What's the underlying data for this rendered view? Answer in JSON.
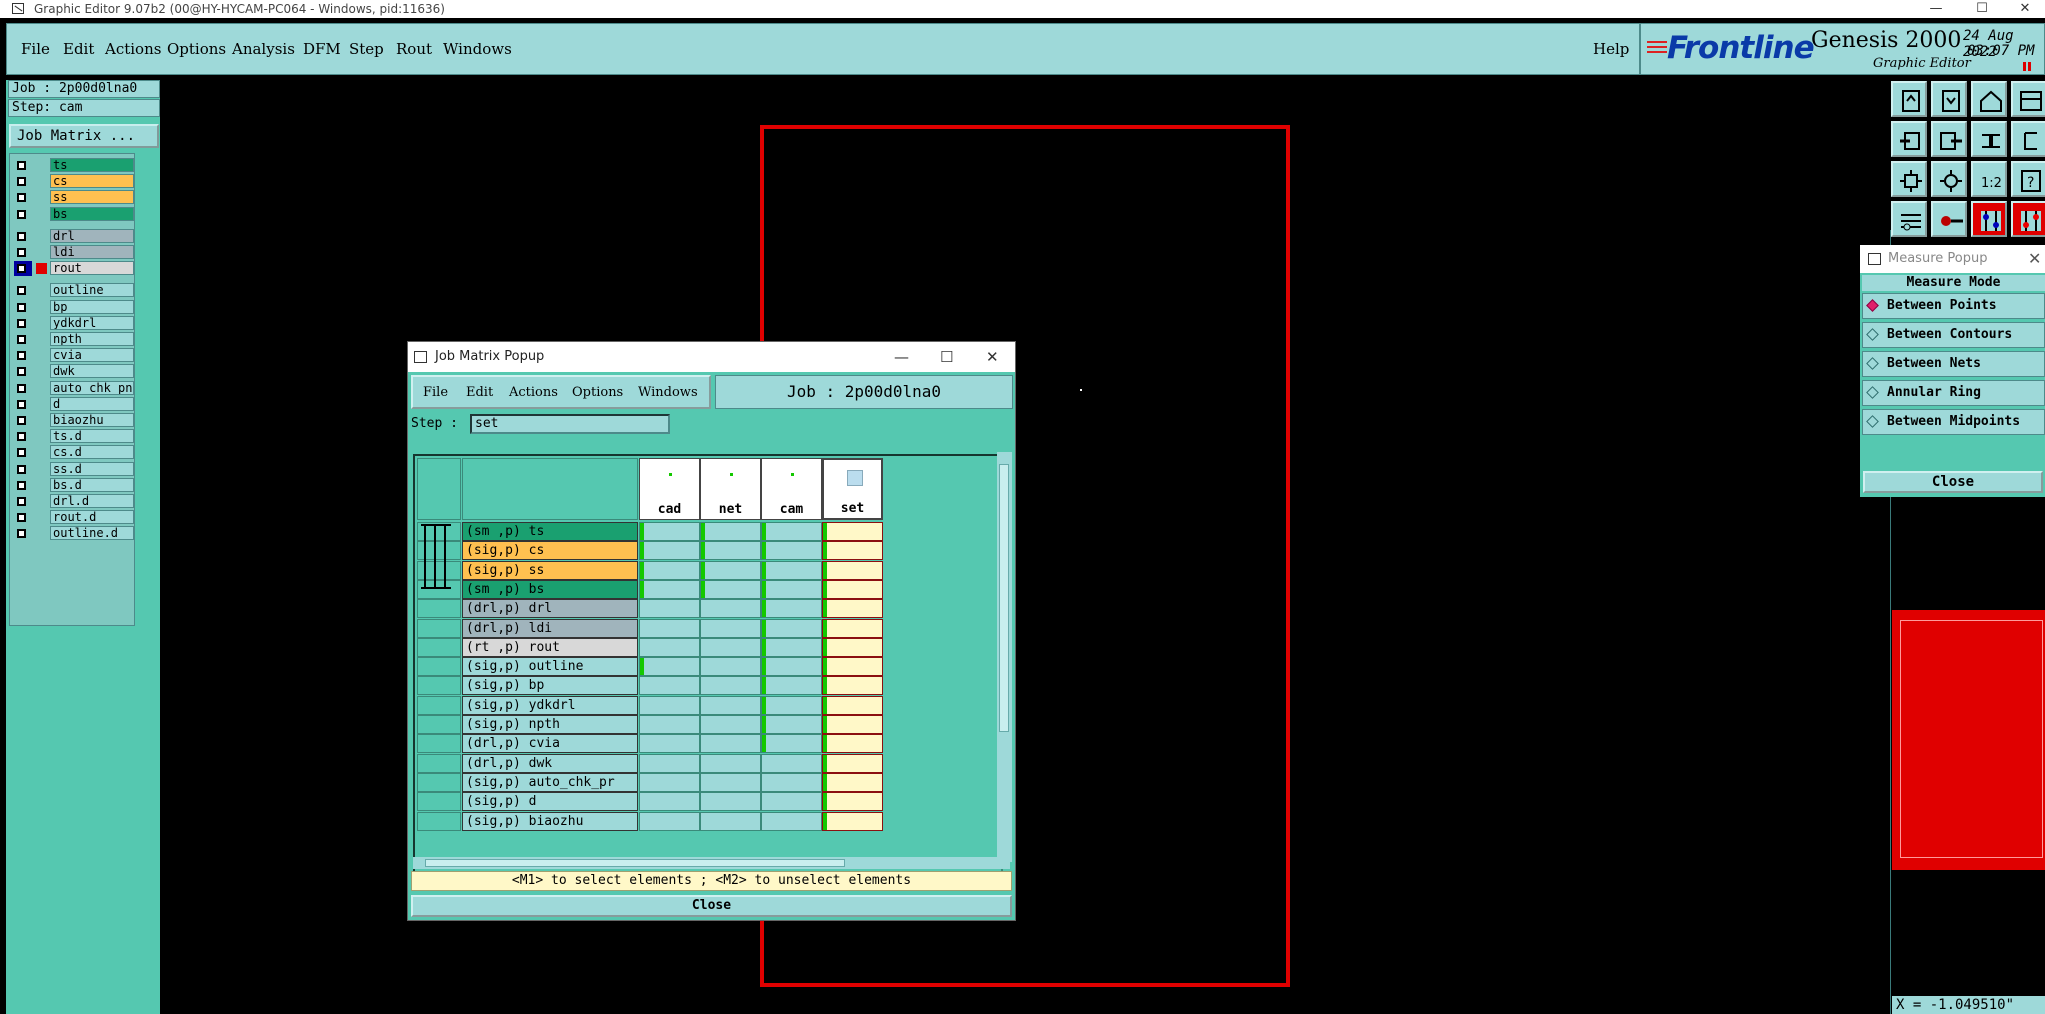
{
  "window": {
    "title": "Graphic Editor 9.07b2 (00@HY-HYCAM-PC064 - Windows, pid:11636)"
  },
  "menubar": {
    "items": [
      "File",
      "Edit",
      "Actions",
      "Options",
      "Analysis",
      "DFM",
      "Step",
      "Rout",
      "Windows"
    ],
    "help": "Help"
  },
  "brand": {
    "logo": "Frontline",
    "product": "Genesis 2000",
    "subtitle": "Graphic Editor",
    "date": "24 Aug 2022",
    "time": "03:07 PM"
  },
  "leftpanel": {
    "job": "Job : 2p00d0lna0",
    "step": "Step: cam",
    "job_matrix_button": "Job Matrix ...",
    "layers": [
      {
        "name": "ts",
        "color": "#1aa070"
      },
      {
        "name": "cs",
        "color": "#ffc050"
      },
      {
        "name": "ss",
        "color": "#ffc050"
      },
      {
        "name": "bs",
        "color": "#1aa070"
      },
      {
        "name": "drl",
        "color": "#a0b4bc"
      },
      {
        "name": "ldi",
        "color": "#a0b4bc"
      },
      {
        "name": "rout",
        "color": "#d8d8d8",
        "selected": true
      },
      {
        "name": "outline",
        "color": "#9ed9d9"
      },
      {
        "name": "bp",
        "color": "#9ed9d9"
      },
      {
        "name": "ydkdrl",
        "color": "#9ed9d9"
      },
      {
        "name": "npth",
        "color": "#9ed9d9"
      },
      {
        "name": "cvia",
        "color": "#9ed9d9"
      },
      {
        "name": "dwk",
        "color": "#9ed9d9"
      },
      {
        "name": "auto_chk_pn.",
        "color": "#9ed9d9"
      },
      {
        "name": "d",
        "color": "#9ed9d9"
      },
      {
        "name": "biaozhu",
        "color": "#9ed9d9"
      },
      {
        "name": "ts.d",
        "color": "#9ed9d9"
      },
      {
        "name": "cs.d",
        "color": "#9ed9d9"
      },
      {
        "name": "ss.d",
        "color": "#9ed9d9"
      },
      {
        "name": "bs.d",
        "color": "#9ed9d9"
      },
      {
        "name": "drl.d",
        "color": "#9ed9d9"
      },
      {
        "name": "rout.d",
        "color": "#9ed9d9"
      },
      {
        "name": "outline.d",
        "color": "#9ed9d9"
      }
    ]
  },
  "measure_popup": {
    "title": "Measure Popup",
    "header": "Measure Mode",
    "options": [
      {
        "label": "Between Points",
        "selected": true
      },
      {
        "label": "Between Contours",
        "selected": false
      },
      {
        "label": "Between Nets",
        "selected": false
      },
      {
        "label": "Annular Ring",
        "selected": false
      },
      {
        "label": "Between Midpoints",
        "selected": false
      }
    ],
    "close": "Close"
  },
  "job_matrix_popup": {
    "title": "Job Matrix Popup",
    "menu": [
      "File",
      "Edit",
      "Actions",
      "Options",
      "Windows"
    ],
    "job_label": "Job : 2p00d0lna0",
    "step_label": "Step :",
    "step_value": "set",
    "columns": [
      "cad",
      "net",
      "cam",
      "set"
    ],
    "rows": [
      {
        "label": "(sm ,p) ts",
        "color": "#1aa070"
      },
      {
        "label": "(sig,p) cs",
        "color": "#ffc050"
      },
      {
        "label": "(sig,p) ss",
        "color": "#ffc050"
      },
      {
        "label": "(sm ,p) bs",
        "color": "#1aa070"
      },
      {
        "label": "(drl,p) drl",
        "color": "#a0b4bc"
      },
      {
        "label": "(drl,p) ldi",
        "color": "#a0b4bc"
      },
      {
        "label": "(rt ,p) rout",
        "color": "#d8d8d8"
      },
      {
        "label": "(sig,p) outline",
        "color": "#9ed9d9"
      },
      {
        "label": "(sig,p) bp",
        "color": "#9ed9d9"
      },
      {
        "label": "(sig,p) ydkdrl",
        "color": "#9ed9d9"
      },
      {
        "label": "(sig,p) npth",
        "color": "#9ed9d9"
      },
      {
        "label": "(drl,p) cvia",
        "color": "#9ed9d9"
      },
      {
        "label": "(drl,p) dwk",
        "color": "#9ed9d9"
      },
      {
        "label": "(sig,p) auto_chk_pr",
        "color": "#9ed9d9"
      },
      {
        "label": "(sig,p) d",
        "color": "#9ed9d9"
      },
      {
        "label": "(sig,p) biaozhu",
        "color": "#9ed9d9"
      }
    ],
    "hint": "<M1> to select elements ; <M2> to unselect elements",
    "close": "Close"
  },
  "coord_readout": "X = -1.049510\"",
  "toolbar_icons": [
    "open-icon",
    "save-icon",
    "home-icon",
    "window-icon",
    "import-icon",
    "export-icon",
    "mirror-icon",
    "step-icon",
    "fit-icon",
    "zoom-icon",
    "scale-icon",
    "help-icon",
    "settings-icon",
    "key-icon",
    "layers-red-icon",
    "layers-red2-icon"
  ]
}
